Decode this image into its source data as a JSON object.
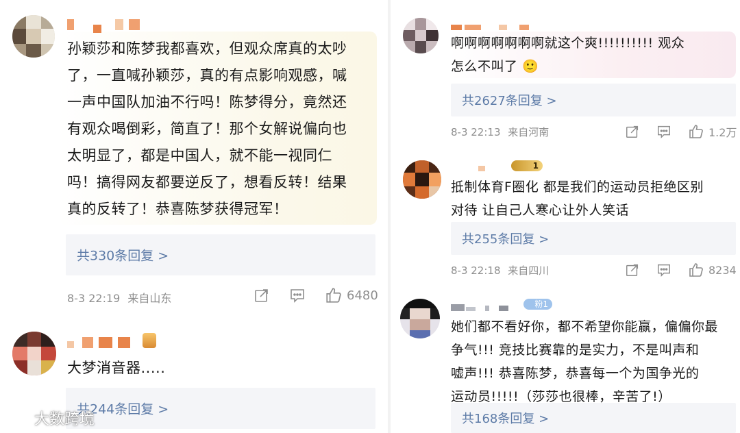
{
  "left_comments": [
    {
      "text_lines": [
        "孙颖莎和陈梦我都喜欢，但观众席真的太吵",
        "了，一直喊孙颖莎，真的有点影响观感，喊",
        "一声中国队加油不行吗！陈梦得分，竟然还",
        "有观众喝倒彩，简直了！那个女解说偏向也",
        "太明显了，都是中国人，就不能一视同仁",
        "吗！搞得网友都要逆反了，想看反转！结果",
        "真的反转了！恭喜陈梦获得冠军！"
      ],
      "replies": "共330条回复 >",
      "time": "8-3 22:19",
      "location": "来自山东",
      "likes": "6480"
    },
    {
      "text_lines": [
        "大梦消音器....."
      ],
      "replies": "共244条回复 >"
    }
  ],
  "right_comments": [
    {
      "text_lines": [
        "啊啊啊啊啊啊啊就这个爽!!!!!!!!!!  观众",
        "怎么不叫了"
      ],
      "emoji": "🙂",
      "replies": "共2627条回复 >",
      "time": "8-3 22:13",
      "location": "来自河南",
      "likes": "1.2万"
    },
    {
      "badge": "1",
      "text_lines": [
        "抵制体育F圈化 都是我们的运动员拒绝区别",
        "对待 让自己人寒心让外人笑话"
      ],
      "replies": "共255条回复 >",
      "time": "8-3 22:18",
      "location": "来自四川",
      "likes": "8234"
    },
    {
      "badge": "粉1",
      "text_lines": [
        "她们都不看好你，都不希望你能赢，偏偏你最",
        "争气!!!  竞技比赛靠的是实力，不是叫声和",
        "嘘声!!!  恭喜陈梦，恭喜每一个为国争光的",
        "运动员!!!!!（莎莎也很棒，辛苦了!）"
      ],
      "replies": "共168条回复 >"
    }
  ],
  "watermark": "大数跨境",
  "icons": [
    "share-icon",
    "comment-icon",
    "like-icon",
    "weibo-logo-icon"
  ],
  "colors": {
    "reply_link": "#5d7ba7",
    "reply_bg": "#f4f5f8",
    "meta": "#8e8e8e"
  }
}
